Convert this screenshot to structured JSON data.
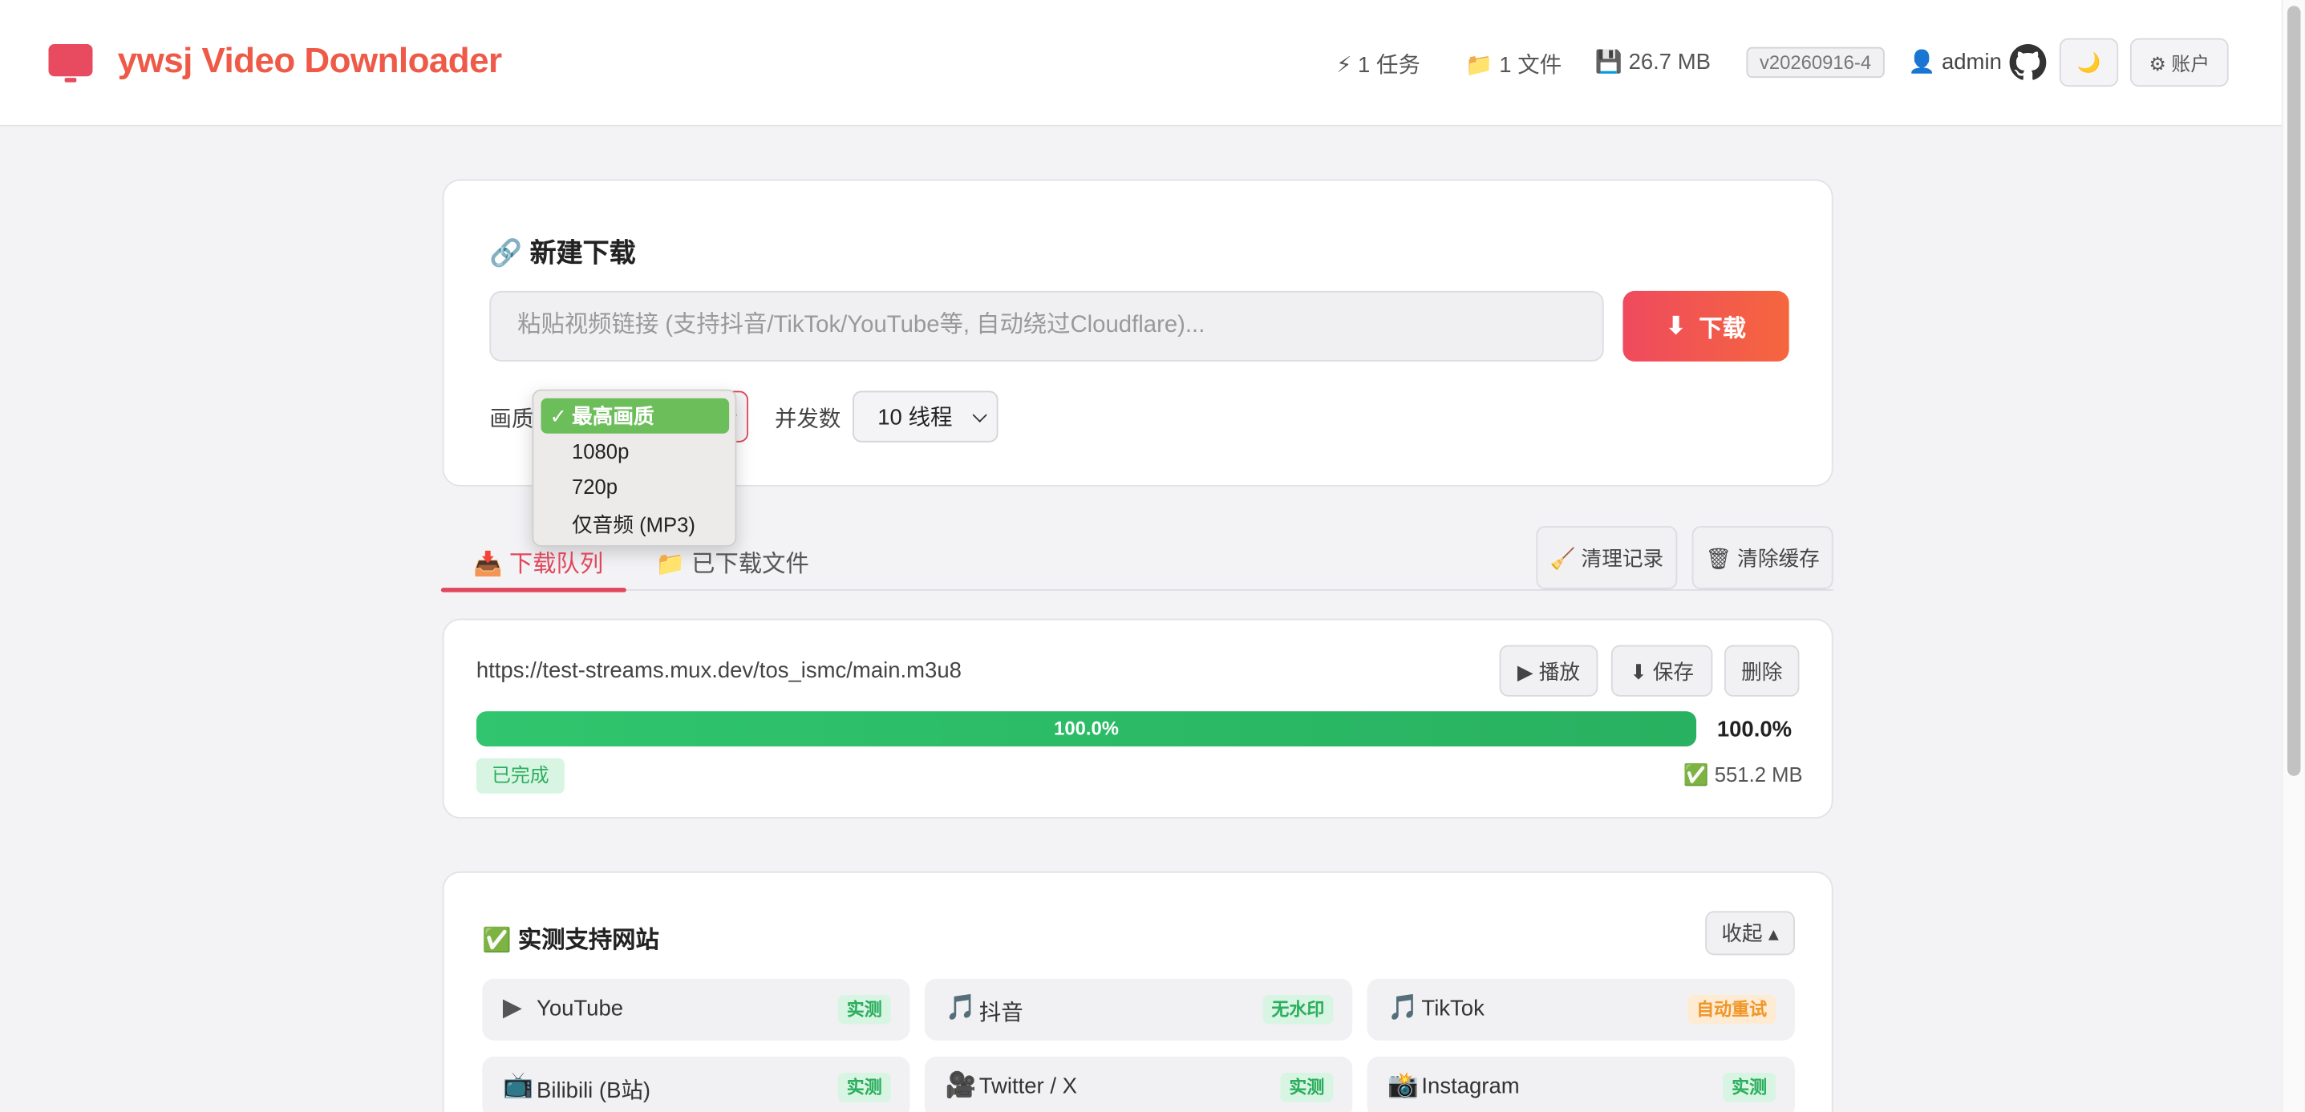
{
  "header": {
    "app_name": "ywsj Video Downloader",
    "stats": {
      "tasks": "⚡ 1 任务",
      "files": "📁 1 文件",
      "storage": "💾 26.7 MB"
    },
    "version": "v20260916-4",
    "user": "👤 admin",
    "theme_toggle": "🌙",
    "account_label": "⚙ 账户"
  },
  "new_download": {
    "title": "🔗 新建下载",
    "url_placeholder": "粘贴视频链接 (支持抖音/TikTok/YouTube等, 自动绕过Cloudflare)...",
    "download_icon": "⬇",
    "download_label": "下载",
    "quality_label": "画质",
    "concurrency_label": "并发数",
    "concurrency_value": "10 线程",
    "quality_options": [
      {
        "label": "最高画质",
        "selected": true,
        "check": "✓"
      },
      {
        "label": "1080p",
        "selected": false
      },
      {
        "label": "720p",
        "selected": false
      },
      {
        "label": "仅音频 (MP3)",
        "selected": false
      }
    ]
  },
  "tabs": {
    "queue": "📥 下载队列",
    "files": "📁 已下载文件",
    "clear_history": "🧹 清理记录",
    "clear_cache": "🗑 清除缓存"
  },
  "queue_item": {
    "url": "https://test-streams.mux.dev/tos_ismc/main.m3u8",
    "play_label": "▶ 播放",
    "save_label": "⬇ 保存",
    "delete_label": "删除",
    "progress": 1.0,
    "progress_text": "100.0%",
    "status": "已完成",
    "size": "✅ 551.2 MB"
  },
  "supported_sites": {
    "title": "✅ 实测支持网站",
    "collapse_label": "收起 ▴",
    "sites": [
      {
        "icon": "▶",
        "name": "YouTube",
        "badge": "实测",
        "badge_color": "green"
      },
      {
        "icon": "🎵",
        "name": "抖音",
        "badge": "无水印",
        "badge_color": "green"
      },
      {
        "icon": "🎵",
        "name": "TikTok",
        "badge": "自动重试",
        "badge_color": "orange"
      },
      {
        "icon": "📺",
        "name": "Bilibili (B站)",
        "badge": "实测",
        "badge_color": "green"
      },
      {
        "icon": "🎥",
        "name": "Twitter / X",
        "badge": "实测",
        "badge_color": "green"
      },
      {
        "icon": "📸",
        "name": "Instagram",
        "badge": "实测",
        "badge_color": "green"
      }
    ]
  },
  "colors": {
    "accent": "#e0475b",
    "brand_orange": "#ef5a48",
    "success": "#2cae5e",
    "progress": "#30c56e"
  }
}
